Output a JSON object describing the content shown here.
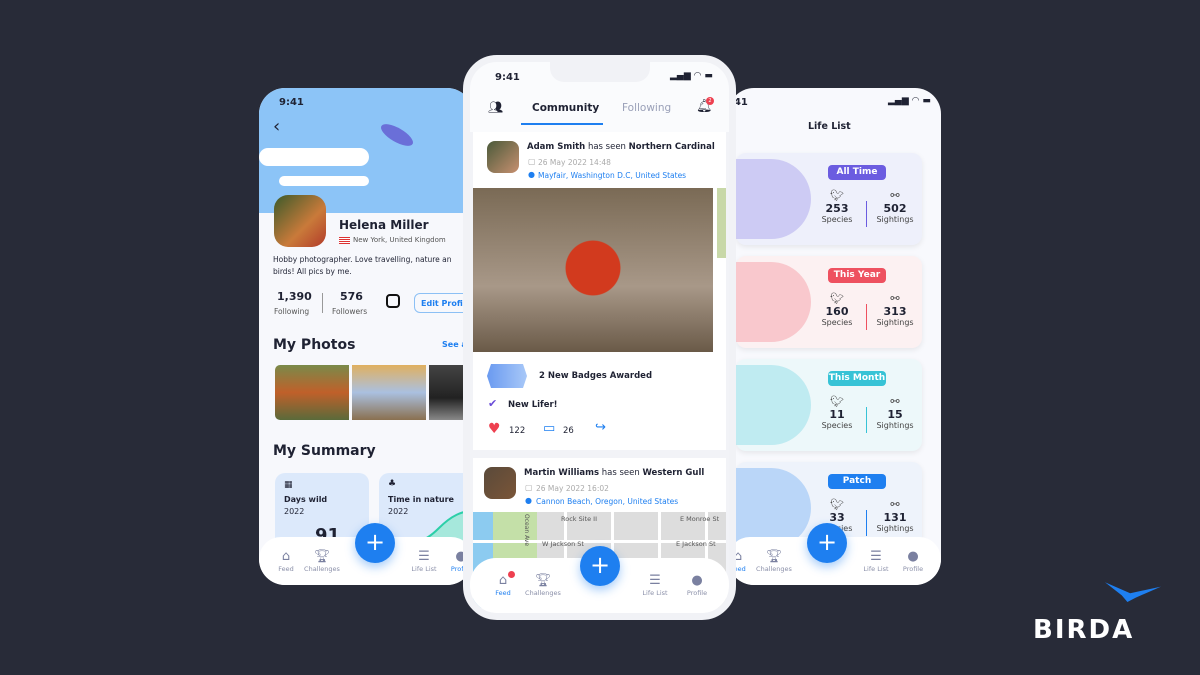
{
  "time": "9:41",
  "profile": {
    "name": "Helena Miller",
    "location": "New York, United Kingdom",
    "bio_line1": "Hobby photographer. Love travelling, nature an",
    "bio_line2": "birds! All pics by me.",
    "following": "1,390",
    "following_label": "Following",
    "followers": "576",
    "followers_label": "Followers",
    "edit_label": "Edit Profile",
    "photos_title": "My Photos",
    "see_all": "See all",
    "summary_title": "My Summary",
    "summary_cards": [
      {
        "title": "Days wild",
        "year": "2022",
        "value": "91"
      },
      {
        "title": "Time in nature",
        "year": "2022"
      }
    ]
  },
  "feed": {
    "tabs": [
      "Community",
      "Following"
    ],
    "notification_count": "2",
    "posts": [
      {
        "user": "Adam Smith",
        "verb": "has seen",
        "species": "Northern Cardinal",
        "date": "26 May 2022  14:48",
        "location": "Mayfair, Washington D.C, United States",
        "badges": "2 New Badges Awarded",
        "lifer": "New Lifer!",
        "likes": "122",
        "comments": "26"
      },
      {
        "user": "Martin Williams",
        "verb": "has seen",
        "species": "Western Gull",
        "date": "26 May 2022  16:02",
        "location": "Cannon Beach, Oregon, United States",
        "map_labels": [
          "Rock Site II",
          "E Monroe St",
          "W Jackson St",
          "E Jackson St",
          "Ocean Ave"
        ]
      }
    ]
  },
  "lifelist": {
    "title": "Life List",
    "species_label": "Species",
    "sightings_label": "Sightings",
    "cards": [
      {
        "label": "All Time",
        "species": "253",
        "sightings": "502",
        "color": "#6b5ce0",
        "bg": "#eef0fb"
      },
      {
        "label": "This Year",
        "species": "160",
        "sightings": "313",
        "color": "#ee5160",
        "bg": "#fcf1f2"
      },
      {
        "label": "This Month",
        "species": "11",
        "sightings": "15",
        "color": "#37c3d6",
        "bg": "#edf8fa"
      },
      {
        "label": "Patch",
        "species": "33",
        "sightings": "131",
        "color": "#1e7ff0",
        "bg": "#eef3fb"
      }
    ]
  },
  "nav": {
    "feed": "Feed",
    "challenges": "Challenges",
    "lifelist": "Life List",
    "profile": "Profile"
  },
  "brand": {
    "name": "BIRDA",
    "accent": "#1e7ff0"
  }
}
